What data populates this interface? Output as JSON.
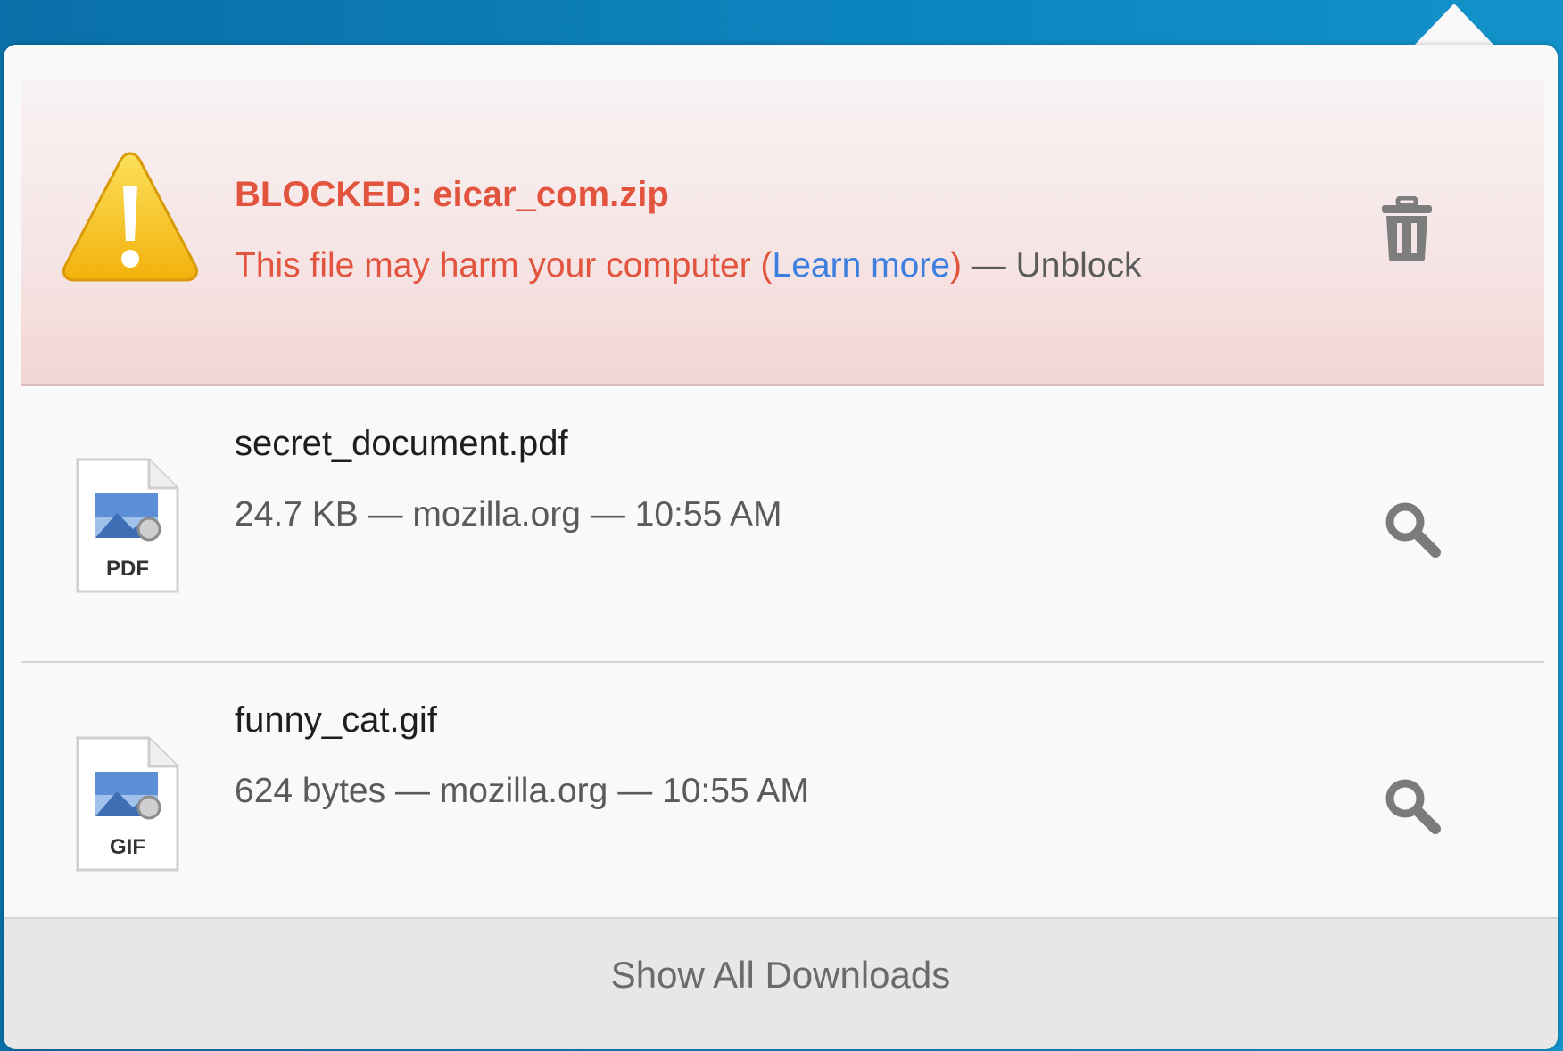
{
  "downloads": [
    {
      "status": "blocked",
      "icon": "warning-triangle-icon",
      "title": "BLOCKED: eicar_com.zip",
      "description_prefix": "This file may harm your computer (",
      "learn_more": "Learn more",
      "description_suffix": ")",
      "separator": " — ",
      "action": "Unblock",
      "action_icon": "trash-icon"
    },
    {
      "status": "complete",
      "icon": "pdf-file-icon",
      "icon_label": "PDF",
      "title": "secret_document.pdf",
      "meta": "24.7 KB — mozilla.org — 10:55 AM",
      "action_icon": "magnifier-icon"
    },
    {
      "status": "complete",
      "icon": "gif-file-icon",
      "icon_label": "GIF",
      "title": "funny_cat.gif",
      "meta": "624 bytes — mozilla.org — 10:55 AM",
      "action_icon": "magnifier-icon"
    }
  ],
  "footer": {
    "label": "Show All Downloads"
  },
  "colors": {
    "blocked_text": "#e2543d",
    "link": "#3c7fe0",
    "header_blue": "#0c84be",
    "warning_yellow": "#f7c21b"
  }
}
